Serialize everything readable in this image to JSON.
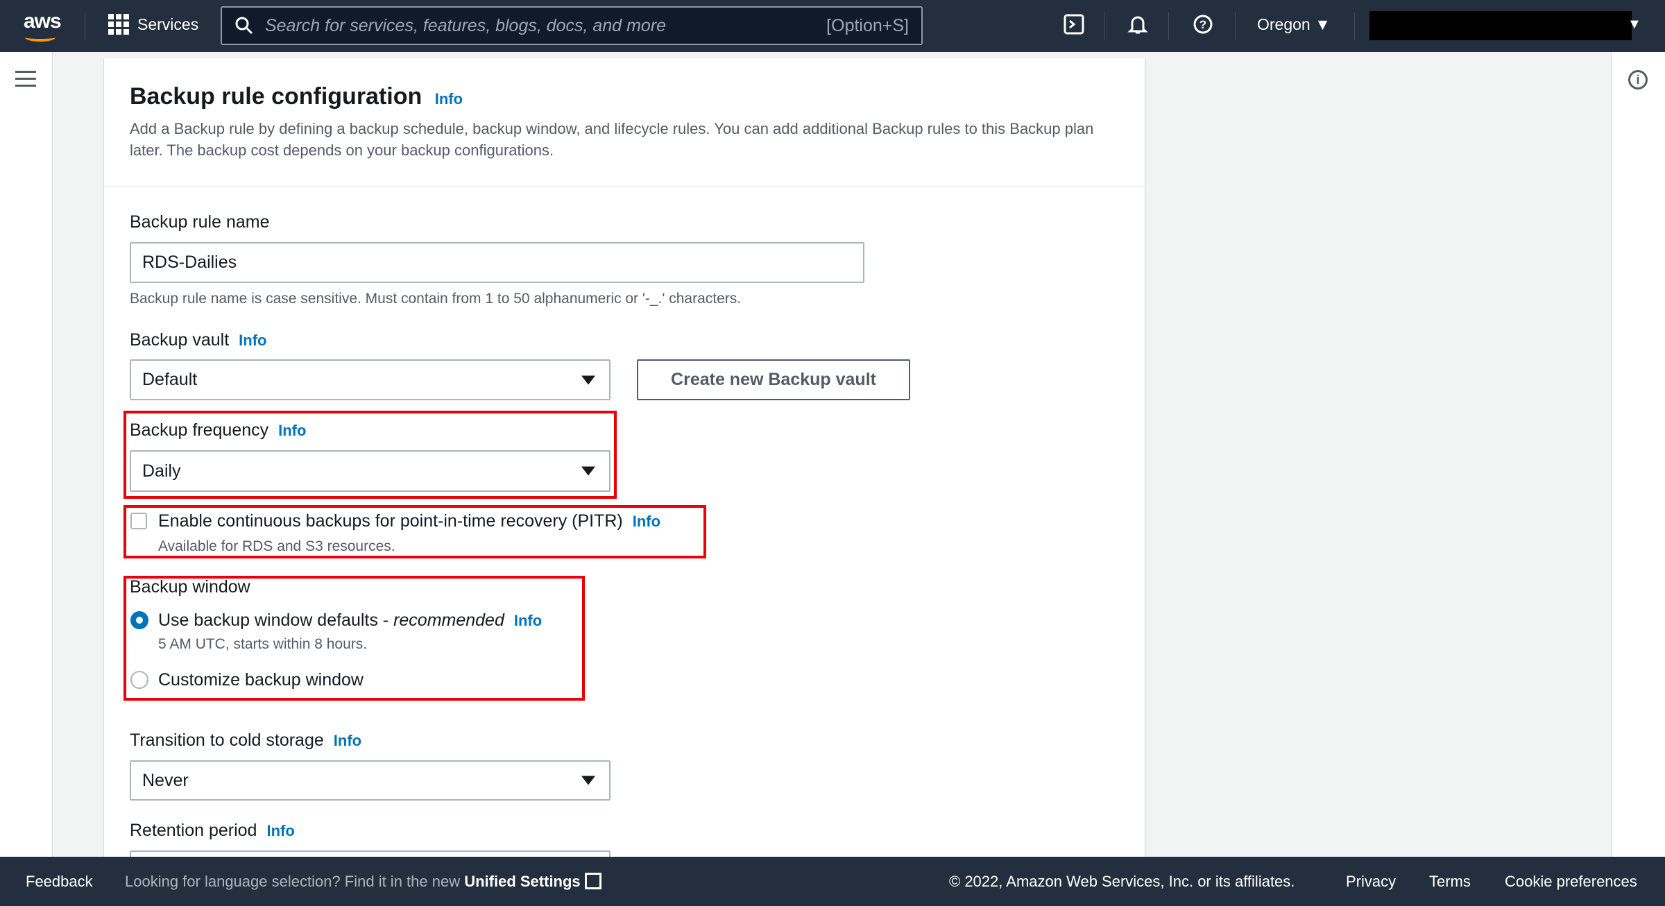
{
  "topbar": {
    "logo": "aws",
    "services": "Services",
    "search_placeholder": "Search for services, features, blogs, docs, and more",
    "search_shortcut": "[Option+S]",
    "region": "Oregon"
  },
  "section": {
    "title": "Backup rule configuration",
    "info": "Info",
    "description": "Add a Backup rule by defining a backup schedule, backup window, and lifecycle rules. You can add additional Backup rules to this Backup plan later. The backup cost depends on your backup configurations."
  },
  "rule_name": {
    "label": "Backup rule name",
    "value": "RDS-Dailies",
    "hint": "Backup rule name is case sensitive. Must contain from 1 to 50 alphanumeric or '-_.' characters."
  },
  "vault": {
    "label": "Backup vault",
    "info": "Info",
    "value": "Default",
    "create_button": "Create new Backup vault"
  },
  "frequency": {
    "label": "Backup frequency",
    "info": "Info",
    "value": "Daily"
  },
  "pitr": {
    "label": "Enable continuous backups for point-in-time recovery (PITR)",
    "info": "Info",
    "hint": "Available for RDS and S3 resources.",
    "checked": false
  },
  "window": {
    "label": "Backup window",
    "default_option": "Use backup window defaults - ",
    "recommended": "recommended",
    "info": "Info",
    "default_hint": "5 AM UTC, starts within 8 hours.",
    "custom_option": "Customize backup window",
    "selected": "default"
  },
  "cold_storage": {
    "label": "Transition to cold storage",
    "info": "Info",
    "value": "Never"
  },
  "retention": {
    "label": "Retention period",
    "info": "Info"
  },
  "footer": {
    "feedback": "Feedback",
    "language_text": "Looking for language selection? Find it in the new ",
    "unified_settings": "Unified Settings",
    "copyright": "© 2022, Amazon Web Services, Inc. or its affiliates.",
    "privacy": "Privacy",
    "terms": "Terms",
    "cookies": "Cookie preferences"
  }
}
